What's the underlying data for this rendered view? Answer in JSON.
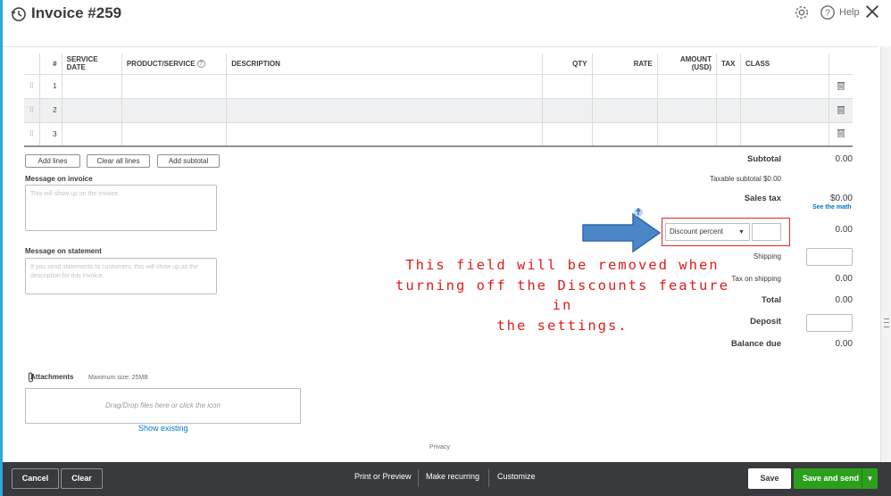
{
  "header": {
    "title": "Invoice #259",
    "help_label": "Help"
  },
  "table": {
    "columns": [
      "#",
      "SERVICE DATE",
      "PRODUCT/SERVICE",
      "DESCRIPTION",
      "QTY",
      "RATE",
      "AMOUNT (USD)",
      "TAX",
      "CLASS"
    ],
    "rows": [
      {
        "num": "1"
      },
      {
        "num": "2"
      },
      {
        "num": "3"
      }
    ]
  },
  "line_buttons": {
    "add_lines": "Add lines",
    "clear_all": "Clear all lines",
    "add_subtotal": "Add subtotal"
  },
  "message_invoice": {
    "label": "Message on invoice",
    "placeholder": "This will show up on the invoice."
  },
  "message_statement": {
    "label": "Message on statement",
    "placeholder": "If you send statements to customers, this will show up as the description for this invoice."
  },
  "attachments": {
    "label": "Attachments",
    "max_size": "Maximum size: 25MB",
    "dropzone": "Drag/Drop files here or click the icon",
    "show_existing": "Show existing"
  },
  "privacy": "Privacy",
  "totals": {
    "subtotal_label": "Subtotal",
    "subtotal_value": "0.00",
    "taxable_subtotal": "Taxable subtotal $0.00",
    "sales_tax_label": "Sales tax",
    "sales_tax_value": "$0.00",
    "see_math": "See the math",
    "discount_option": "Discount percent",
    "discount_value": "0.00",
    "shipping_label": "Shipping",
    "tax_on_shipping_label": "Tax on shipping",
    "tax_on_shipping_value": "0.00",
    "total_label": "Total",
    "total_value": "0.00",
    "deposit_label": "Deposit",
    "balance_label": "Balance due",
    "balance_value": "0.00"
  },
  "annotation": {
    "line1": "This field will be removed when",
    "line2": "turning off the Discounts feature in",
    "line3": "the settings."
  },
  "footer": {
    "cancel": "Cancel",
    "clear": "Clear",
    "print_preview": "Print or Preview",
    "make_recurring": "Make recurring",
    "customize": "Customize",
    "save": "Save",
    "save_and_send": "Save and send"
  },
  "colors": {
    "accent_blue": "#0077c5",
    "primary_green": "#2ca01c",
    "footer_dark": "#393a3d",
    "annotation_red": "#e01b1b",
    "arrow_blue": "#4a86c8"
  }
}
